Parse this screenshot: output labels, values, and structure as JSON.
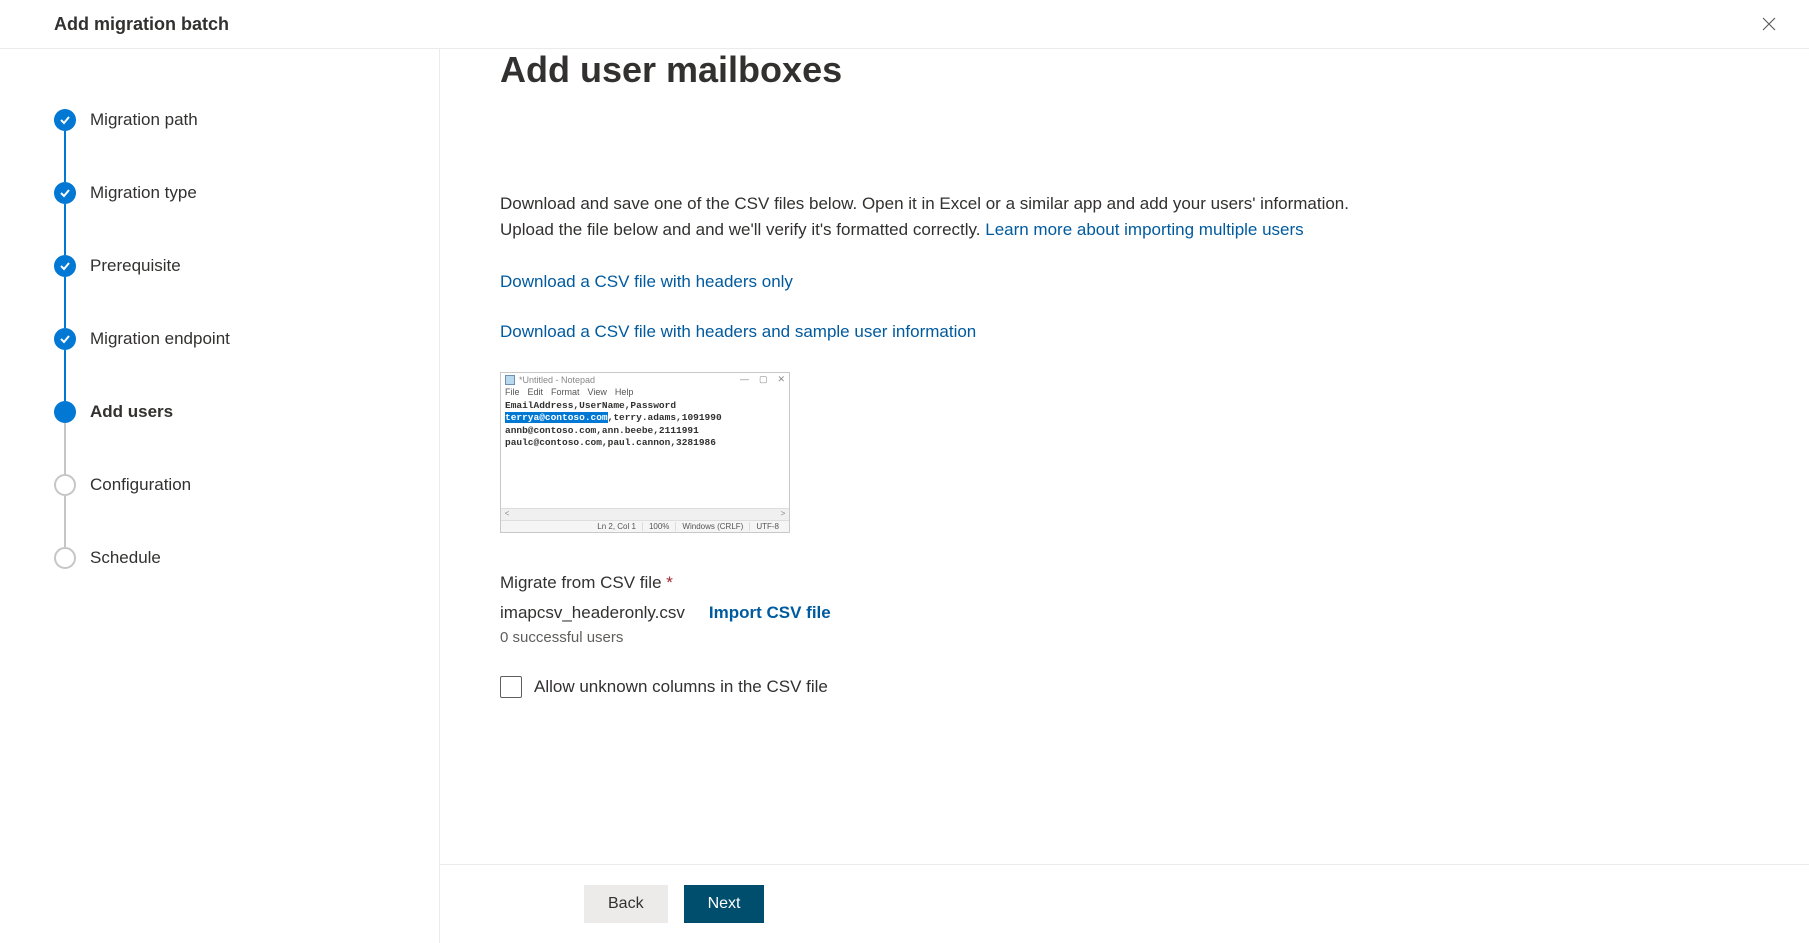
{
  "header": {
    "title": "Add migration batch"
  },
  "steps": [
    {
      "label": "Migration path",
      "state": "completed"
    },
    {
      "label": "Migration type",
      "state": "completed"
    },
    {
      "label": "Prerequisite",
      "state": "completed"
    },
    {
      "label": "Migration endpoint",
      "state": "completed"
    },
    {
      "label": "Add users",
      "state": "current"
    },
    {
      "label": "Configuration",
      "state": "pending"
    },
    {
      "label": "Schedule",
      "state": "pending"
    }
  ],
  "content": {
    "title": "Add user mailboxes",
    "description_part1": "Download and save one of the CSV files below. Open it in Excel or a similar app and add your users' information. Upload the file below and and we'll verify it's formatted correctly. ",
    "learn_more": "Learn more about importing multiple users",
    "download_headers_only": "Download a CSV file with headers only",
    "download_sample": "Download a CSV file with headers and sample user information",
    "notepad": {
      "title": "*Untitled - Notepad",
      "menu": [
        "File",
        "Edit",
        "Format",
        "View",
        "Help"
      ],
      "line1": "EmailAddress,UserName,Password",
      "line2_highlight": "terrya@contoso.com",
      "line2_rest": ",terry.adams,1091990",
      "line3": "annb@contoso.com,ann.beebe,2111991",
      "line4": "paulc@contoso.com,paul.cannon,3281986",
      "status_lncol": "Ln 2, Col 1",
      "status_zoom": "100%",
      "status_eol": "Windows (CRLF)",
      "status_enc": "UTF-8"
    },
    "migrate_label": "Migrate from CSV file ",
    "file_name": "imapcsv_headeronly.csv",
    "import_link": "Import CSV file",
    "status_text": "0 successful users",
    "checkbox_label": "Allow unknown columns in the CSV file"
  },
  "footer": {
    "back": "Back",
    "next": "Next"
  }
}
